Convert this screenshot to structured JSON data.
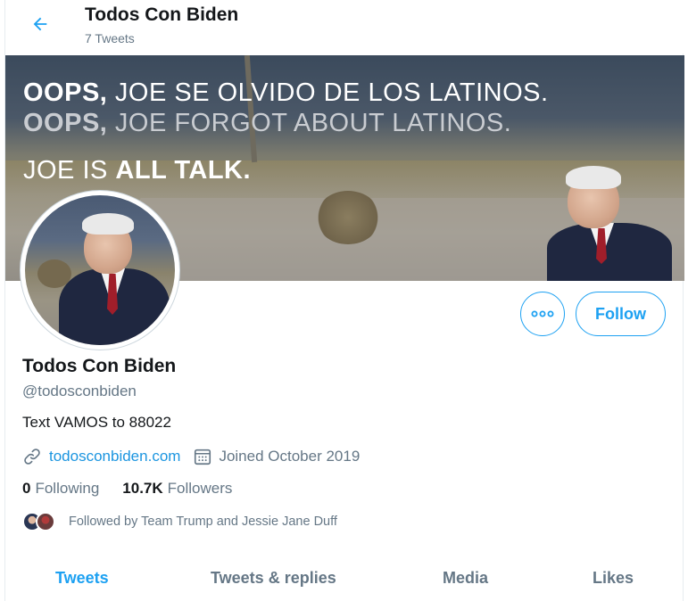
{
  "header": {
    "title": "Todos Con Biden",
    "tweet_count": "7 Tweets"
  },
  "banner": {
    "line1_bold": "OOPS,",
    "line1_rest": " JOE SE OLVIDO DE LOS LATINOS.",
    "line2_bold": "OOPS,",
    "line2_rest": " JOE FORGOT ABOUT LATINOS.",
    "line3_prefix": "JOE IS ",
    "line3_bold": "ALL TALK."
  },
  "actions": {
    "follow_label": "Follow"
  },
  "profile": {
    "name": "Todos Con Biden",
    "handle": "@todosconbiden",
    "bio": "Text VAMOS to 88022",
    "url": "todosconbiden.com",
    "joined": "Joined October 2019",
    "following_count": "0",
    "following_label": "Following",
    "followers_count": "10.7K",
    "followers_label": "Followers",
    "followed_by": "Followed by Team Trump and Jessie Jane Duff"
  },
  "tabs": [
    {
      "label": "Tweets",
      "active": true
    },
    {
      "label": "Tweets & replies",
      "active": false
    },
    {
      "label": "Media",
      "active": false
    },
    {
      "label": "Likes",
      "active": false
    }
  ],
  "colors": {
    "accent": "#1da1f2",
    "link": "#1b95e0",
    "secondary_text": "#657786"
  }
}
